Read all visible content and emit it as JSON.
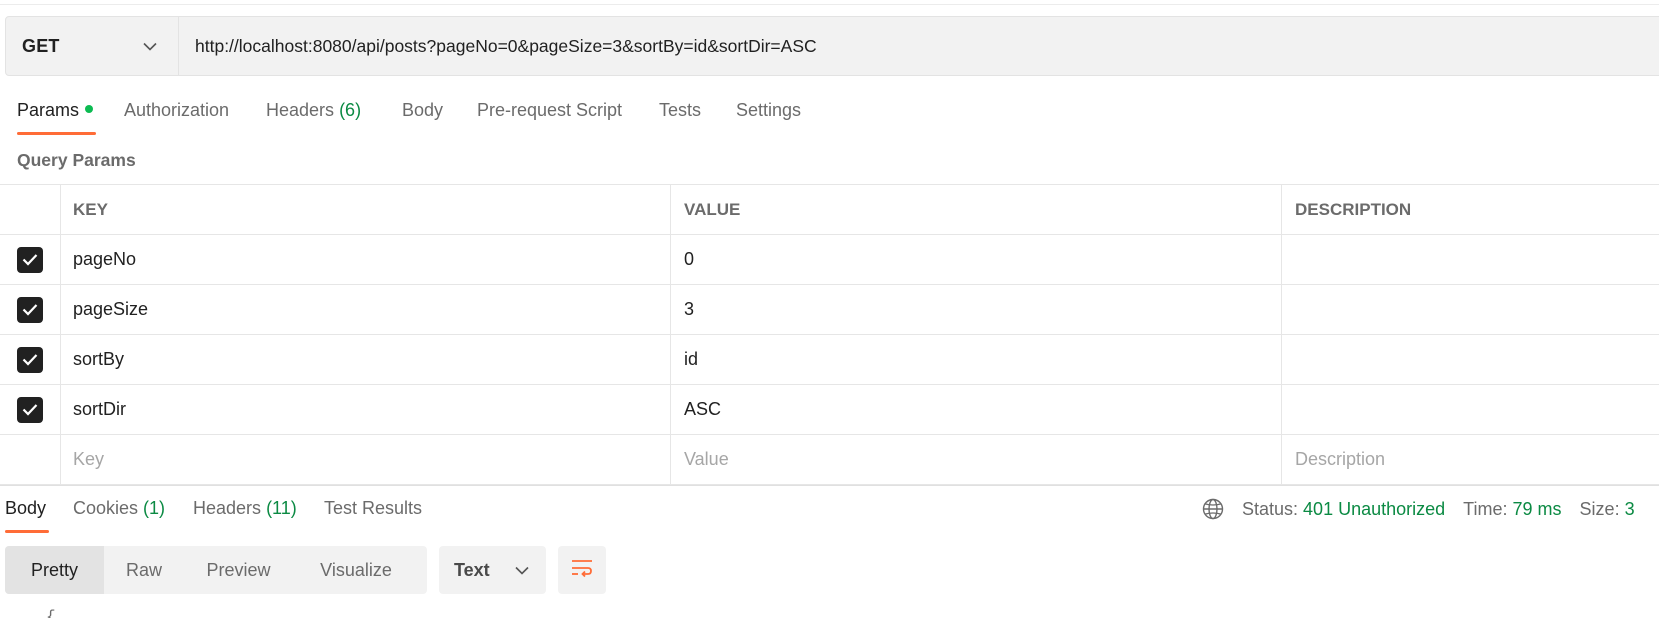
{
  "request": {
    "method": "GET",
    "url": "http://localhost:8080/api/posts?pageNo=0&pageSize=3&sortBy=id&sortDir=ASC"
  },
  "request_tabs": [
    {
      "label": "Params",
      "active": true
    },
    {
      "label": "Authorization"
    },
    {
      "label": "Headers",
      "count": "(6)"
    },
    {
      "label": "Body"
    },
    {
      "label": "Pre-request Script"
    },
    {
      "label": "Tests"
    },
    {
      "label": "Settings"
    }
  ],
  "query_params": {
    "title": "Query Params",
    "headers": {
      "key": "KEY",
      "value": "VALUE",
      "description": "DESCRIPTION"
    },
    "rows": [
      {
        "key": "pageNo",
        "value": "0",
        "checked": true
      },
      {
        "key": "pageSize",
        "value": "3",
        "checked": true
      },
      {
        "key": "sortBy",
        "value": "id",
        "checked": true
      },
      {
        "key": "sortDir",
        "value": "ASC",
        "checked": true
      }
    ],
    "placeholders": {
      "key": "Key",
      "value": "Value",
      "description": "Description"
    }
  },
  "response_tabs": [
    {
      "label": "Body",
      "active": true
    },
    {
      "label": "Cookies",
      "count": "(1)"
    },
    {
      "label": "Headers",
      "count": "(11)"
    },
    {
      "label": "Test Results"
    }
  ],
  "response_status": {
    "status_label": "Status:",
    "status_value": "401 Unauthorized",
    "time_label": "Time:",
    "time_value": "79 ms",
    "size_label": "Size:",
    "size_value": "3"
  },
  "view_modes": [
    "Pretty",
    "Raw",
    "Preview",
    "Visualize"
  ],
  "format": "Text",
  "body_peek": "{",
  "colors": {
    "accent": "#ff6c37",
    "success": "#0b8a43",
    "dot": "#0cbb52"
  }
}
